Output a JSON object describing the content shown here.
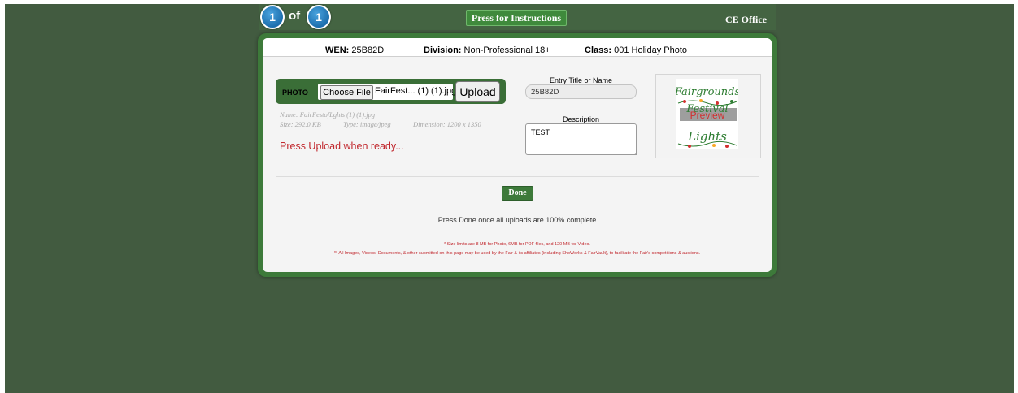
{
  "pager": {
    "current": "1",
    "of_label": "of",
    "total": "1"
  },
  "header": {
    "instructions_label": "Press for Instructions",
    "office_label": "CE Office"
  },
  "entry": {
    "wen_label": "WEN:",
    "wen_value": "25B82D",
    "division_label": "Division:",
    "division_value": "Non-Professional 18+",
    "class_label": "Class:",
    "class_value": "001 Holiday Photo"
  },
  "upload": {
    "photo_label": "PHOTO",
    "choose_file_label": "Choose File",
    "file_name": "FairFest... (1) (1).jpg",
    "upload_label": "Upload",
    "meta_name": "Name: FairFestofLghts (1) (1).jpg",
    "meta_size": "Size: 292.0 KB",
    "meta_type": "Type: image/jpeg",
    "meta_dimension": "Dimension: 1200 x 1350",
    "status": "Press Upload when ready..."
  },
  "form": {
    "title_label": "Entry Title or Name",
    "title_value": "25B82D",
    "description_label": "Description",
    "description_value": "TEST"
  },
  "preview": {
    "line1": "Fairgrounds",
    "line2": "Festival",
    "line3": "Lights",
    "overlay": "Preview",
    "accent_green": "#2e7d32",
    "accent_red": "#d32f2f"
  },
  "footer": {
    "done_label": "Done",
    "done_note": "Press Done once all uploads are 100% complete",
    "size_note": "* Size limits are 8 MB for Photo, 6MB for PDF files, and 120 MB for Video.",
    "rights_note": "** All Images, Videos, Documents, & other submitted on this page may be used by the Fair & its affiliates (including ShoWorks & FairVault), to facilitate the Fair's competitions & auctions."
  },
  "colors": {
    "background": "#425b40",
    "panel_border": "#3d7a3a",
    "button_green": "#3d7a3a",
    "alert_red": "#c1272d"
  }
}
